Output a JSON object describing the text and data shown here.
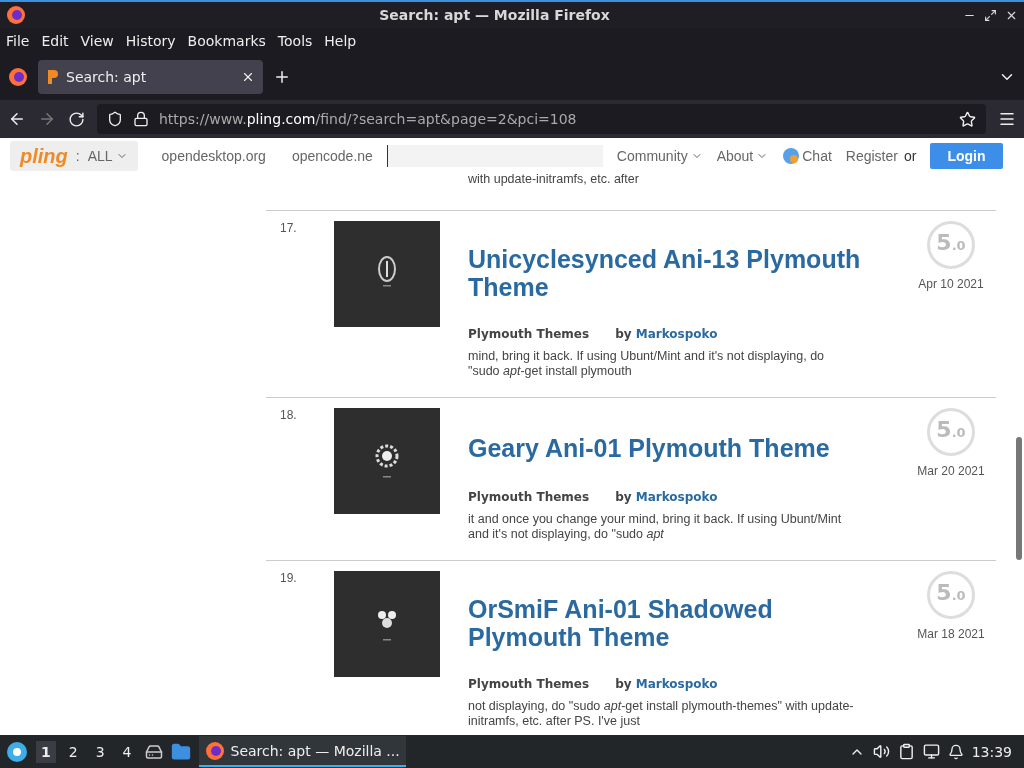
{
  "window": {
    "title": "Search: apt — Mozilla Firefox"
  },
  "menu": [
    "File",
    "Edit",
    "View",
    "History",
    "Bookmarks",
    "Tools",
    "Help"
  ],
  "tabs": [
    {
      "label": "Search: apt",
      "selected": true
    }
  ],
  "address_bar": {
    "url": "https://www.**pling.com**/find/?search=apt&page=2&pci=108"
  },
  "site_header": {
    "logo": "pling",
    "separator": ":",
    "scope": "ALL",
    "links": [
      "opendesktop.org",
      "opencode.ne"
    ],
    "menus": [
      "Community",
      "About"
    ],
    "chat": "Chat",
    "register": "Register",
    "or": "or",
    "login": "Login"
  },
  "previous_snippet": "with update-initramfs, etc. after",
  "results": [
    {
      "number": "17.",
      "title": "Unicyclesynced Ani-13 Plymouth Theme",
      "category": "Plymouth Themes",
      "by": "by",
      "author": "Markospoko",
      "snippet": "mind, bring it back. If using Ubunt/Mint and it's not displaying, do \"sudo *apt*-get install plymouth",
      "score": "5",
      "score_decimal": ".0",
      "date": "Apr 10 2021"
    },
    {
      "number": "18.",
      "title": "Geary Ani-01 Plymouth Theme",
      "category": "Plymouth Themes",
      "by": "by",
      "author": "Markospoko",
      "snippet": "it and once you change your mind, bring it back. If using Ubunt/Mint and it's not displaying, do \"sudo *apt*",
      "score": "5",
      "score_decimal": ".0",
      "date": "Mar 20 2021"
    },
    {
      "number": "19.",
      "title": "OrSmiF Ani-01 Shadowed Plymouth Theme",
      "category": "Plymouth Themes",
      "by": "by",
      "author": "Markospoko",
      "snippet": "not displaying, do \"sudo *apt*-get install plymouth-themes\" with update-initramfs, etc. after PS. I've just",
      "score": "5",
      "score_decimal": ".0",
      "date": "Mar 18 2021"
    }
  ],
  "taskbar": {
    "workspaces": [
      {
        "label": "1",
        "selected": true
      },
      {
        "label": "2",
        "selected": false
      },
      {
        "label": "3",
        "selected": false
      },
      {
        "label": "4",
        "selected": false
      }
    ],
    "task": "Search: apt — Mozilla ...",
    "clock": "13:39"
  }
}
